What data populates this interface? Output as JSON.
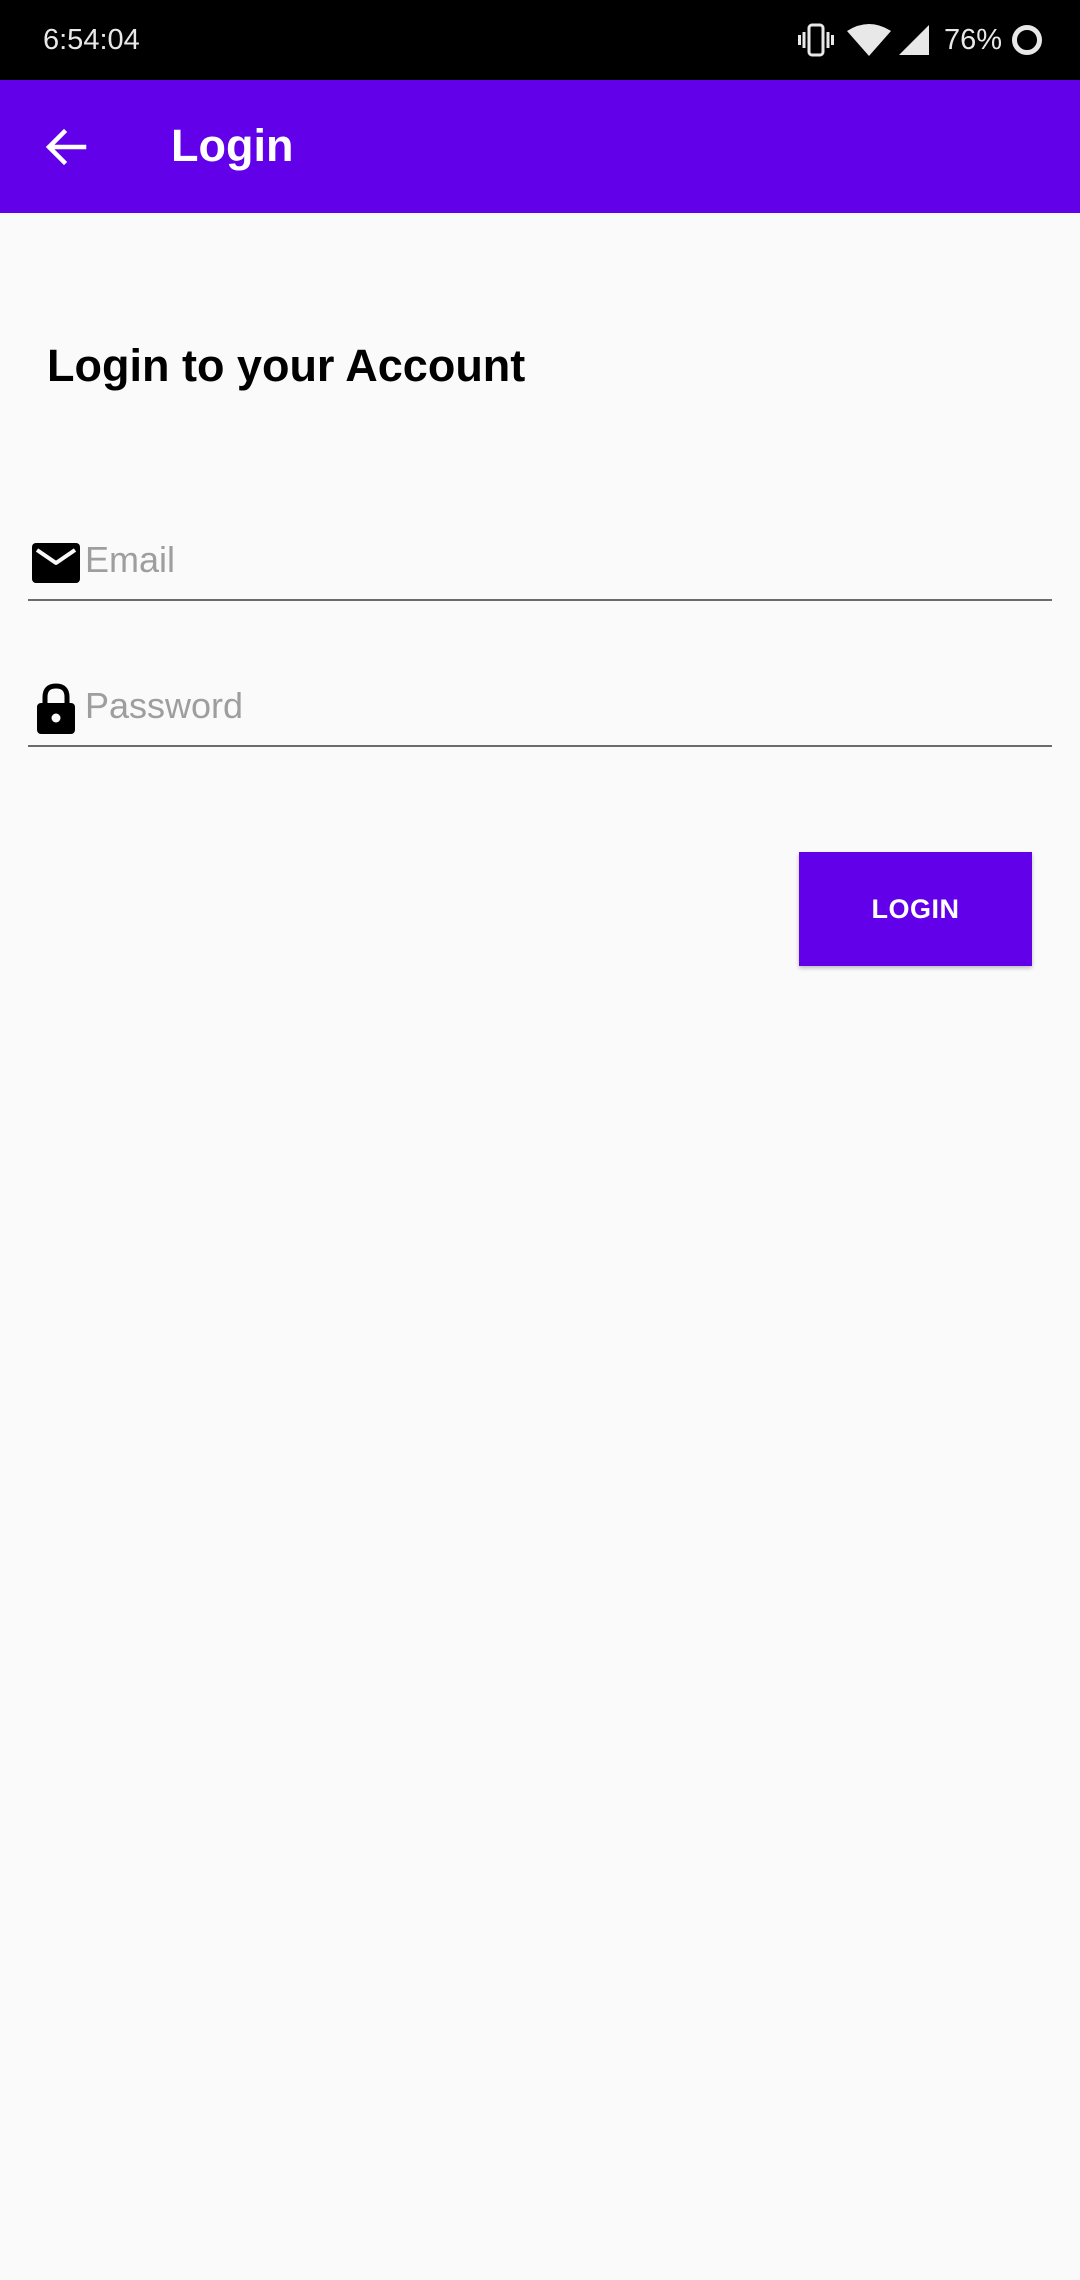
{
  "status_bar": {
    "time": "6:54:04",
    "battery_percent": "76%",
    "icons": [
      "vibrate-icon",
      "wifi-icon",
      "signal-icon",
      "battery-ring-icon"
    ]
  },
  "app_bar": {
    "title": "Login",
    "back_icon": "arrow-back-icon",
    "color": "#6200ea"
  },
  "form": {
    "heading": "Login to your Account",
    "email": {
      "icon": "mail-icon",
      "value": "",
      "placeholder": "Email"
    },
    "password": {
      "icon": "lock-icon",
      "value": "",
      "placeholder": "Password"
    },
    "login_button_label": "LOGIN"
  },
  "colors": {
    "accent": "#6200ea",
    "background": "#fafafa",
    "placeholder": "#9e9e9e"
  }
}
